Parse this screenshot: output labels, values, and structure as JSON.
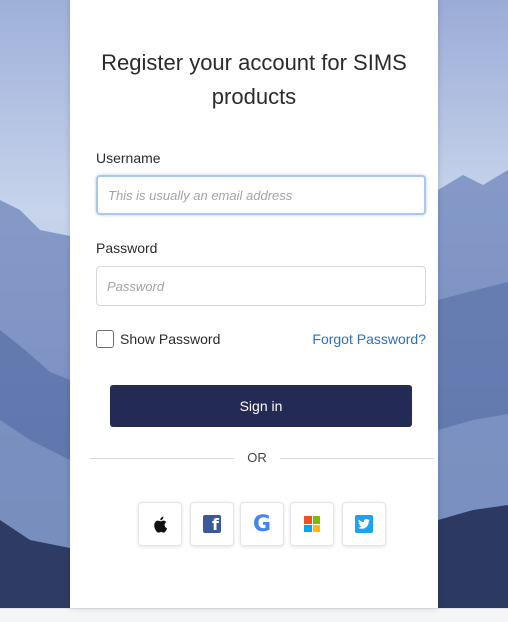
{
  "page": {
    "title_line1": "Register your account for SIMS",
    "title_line2": "products"
  },
  "form": {
    "username_label": "Username",
    "username_placeholder": "This is usually an email address",
    "username_value": "",
    "password_label": "Password",
    "password_placeholder": "Password",
    "password_value": "",
    "show_password_label": "Show Password",
    "show_password_checked": false,
    "forgot_password_label": "Forgot Password?",
    "signin_label": "Sign in",
    "or_label": "OR"
  },
  "social": [
    {
      "icon": "apple-icon",
      "provider": "Apple"
    },
    {
      "icon": "facebook-icon",
      "provider": "Facebook",
      "color": "#3b5998"
    },
    {
      "icon": "google-icon",
      "provider": "Google",
      "color": "#4285f4"
    },
    {
      "icon": "microsoft-icon",
      "provider": "Microsoft",
      "colors": [
        "#f25022",
        "#7fba00",
        "#00a4ef",
        "#ffb900"
      ]
    },
    {
      "icon": "twitter-icon",
      "provider": "Twitter",
      "color": "#1da1f2"
    }
  ],
  "colors": {
    "signin_bg": "#232a54",
    "link": "#2f6fb8",
    "focus_border": "#a9c8ee"
  }
}
